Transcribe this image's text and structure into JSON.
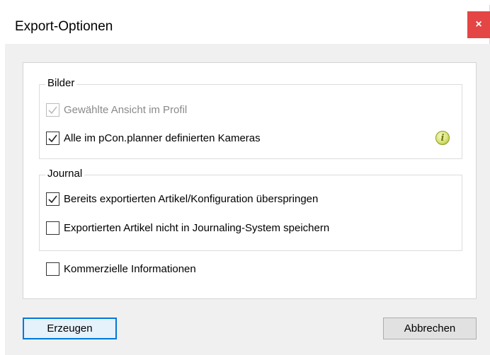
{
  "dialog": {
    "title": "Export-Optionen",
    "close_symbol": "×"
  },
  "groups": {
    "bilder": {
      "legend": "Bilder",
      "options": [
        {
          "label": "Gewählte Ansicht im Profil",
          "checked": true,
          "disabled": true
        },
        {
          "label": "Alle im pCon.planner definierten Kameras",
          "checked": true,
          "disabled": false
        }
      ],
      "info_icon_glyph": "i"
    },
    "journal": {
      "legend": "Journal",
      "options": [
        {
          "label": "Bereits exportierten Artikel/Konfiguration überspringen",
          "checked": true,
          "disabled": false
        },
        {
          "label": "Exportierten Artikel nicht in Journaling-System speichern",
          "checked": false,
          "disabled": false
        }
      ]
    }
  },
  "standalone_option": {
    "label": "Kommerzielle Informationen",
    "checked": false,
    "disabled": false
  },
  "buttons": {
    "create_label": "Erzeugen",
    "cancel_label": "Abbrechen"
  },
  "colors": {
    "close_button": "#e44545",
    "primary_button_border": "#0078d7",
    "info_icon": "#d9e27a"
  },
  "icons": {
    "close": "close-icon",
    "info": "info-icon",
    "check": "checkmark-icon"
  }
}
